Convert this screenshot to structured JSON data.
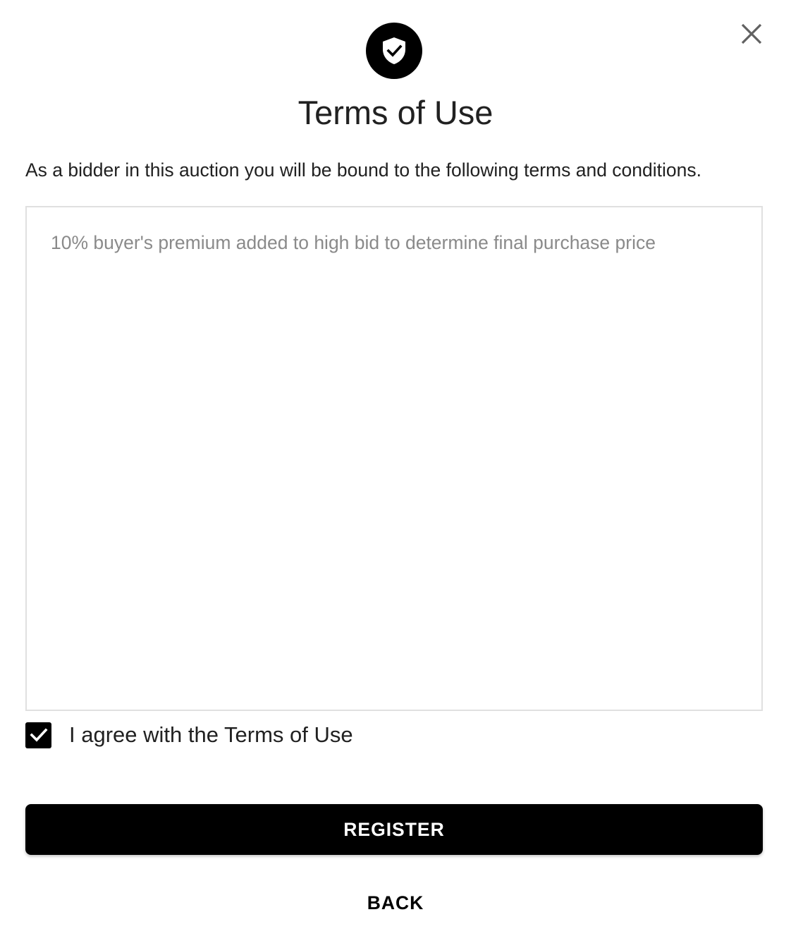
{
  "dialog": {
    "title": "Terms of Use",
    "subtitle": "As a bidder in this auction you will be bound to the following terms and conditions.",
    "header_icon": "shield-check-icon",
    "close_icon": "close-icon"
  },
  "terms": {
    "content": "10% buyer's premium added to high bid to determine final purchase price"
  },
  "agreement": {
    "label": "I agree with the Terms of Use",
    "checked": true
  },
  "actions": {
    "register_label": "REGISTER",
    "back_label": "BACK"
  },
  "colors": {
    "primary": "#000000",
    "text": "#212121",
    "muted_text": "#8a8a8a",
    "border": "#e0e0e0",
    "background": "#ffffff"
  }
}
